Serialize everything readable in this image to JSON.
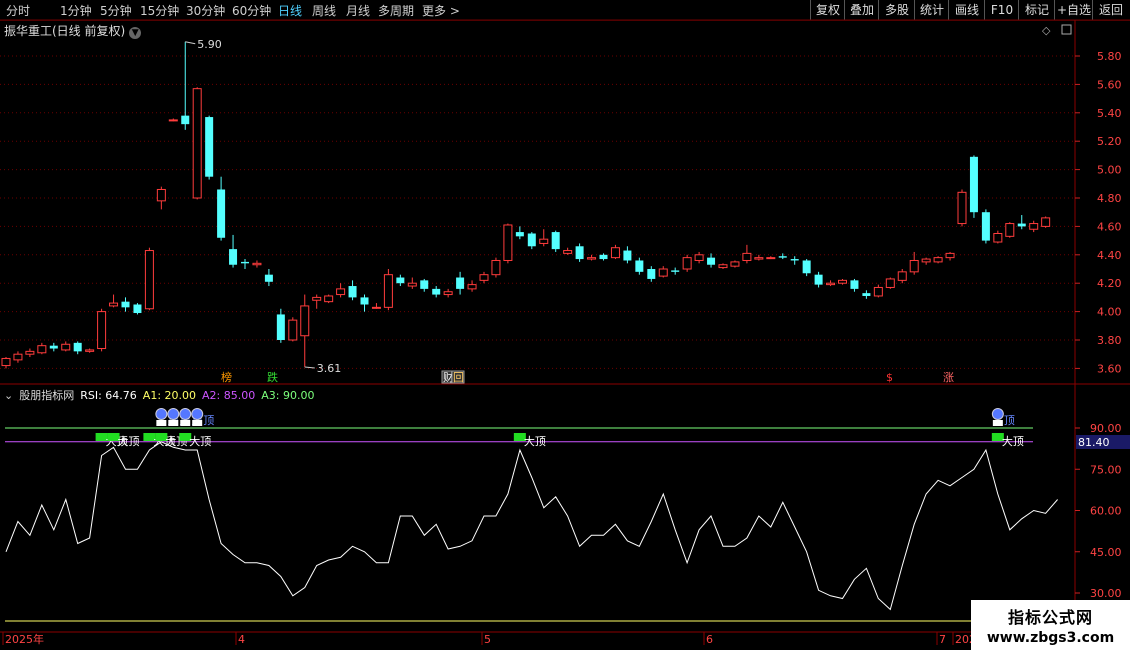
{
  "topbar": {
    "periods": [
      "分时",
      "1分钟",
      "5分钟",
      "15分钟",
      "30分钟",
      "60分钟",
      "日线",
      "周线",
      "月线",
      "多周期",
      "更多 >"
    ],
    "active_period": "日线",
    "buttons": [
      "复权",
      "叠加",
      "多股",
      "统计",
      "画线",
      "F10",
      "标记",
      "+自选",
      "返回"
    ]
  },
  "chart_title": "振华重工(日线 前复权)",
  "price_axis": [
    "5.80",
    "5.60",
    "5.40",
    "5.20",
    "5.00",
    "4.80",
    "4.60",
    "4.40",
    "4.20",
    "4.00",
    "3.80",
    "3.60"
  ],
  "high_label": "5.90",
  "low_label": "3.61",
  "event_markers": [
    {
      "text": "榜",
      "color": "#ff9900"
    },
    {
      "text": "跌",
      "color": "#33dd33"
    },
    {
      "text": "财",
      "color": "#ffffff"
    },
    {
      "text": "回",
      "color": "#ffcc66"
    },
    {
      "text": "$",
      "color": "#ff3333"
    },
    {
      "text": "涨",
      "color": "#ff6666"
    }
  ],
  "indicator": {
    "name": "股朋指标网",
    "rsi_label": "RSI: 64.76",
    "a1_label": "A1: 20.00",
    "a2_label": "A2: 85.00",
    "a3_label": "A3: 90.00",
    "current_tag": "81.40",
    "axis": [
      "90.00",
      "75.00",
      "60.00",
      "45.00",
      "30.00"
    ],
    "signal_texts": {
      "big_top": "大顶",
      "top": "顶"
    }
  },
  "date_axis": [
    "2025年",
    "4",
    "5",
    "6",
    "7",
    "2025"
  ],
  "colors": {
    "up": "#ff3c3c",
    "down": "#54ffff",
    "grid": "#6b0000",
    "a3": "#7cff7c",
    "a2": "#cc55ff",
    "a1": "#ffff66",
    "rsi": "#ffffff"
  },
  "logo": {
    "line1": "指标公式网",
    "line2": "www.zbgs3.com"
  },
  "chart_data": {
    "type": "candlestick",
    "ylim": [
      3.55,
      5.95
    ],
    "candles": [
      [
        3.62,
        3.67,
        3.6,
        3.68
      ],
      [
        3.66,
        3.7,
        3.64,
        3.72
      ],
      [
        3.7,
        3.72,
        3.68,
        3.74
      ],
      [
        3.71,
        3.76,
        3.7,
        3.78
      ],
      [
        3.76,
        3.74,
        3.72,
        3.78
      ],
      [
        3.73,
        3.77,
        3.72,
        3.79
      ],
      [
        3.78,
        3.72,
        3.7,
        3.79
      ],
      [
        3.72,
        3.73,
        3.71,
        3.74
      ],
      [
        3.74,
        4.0,
        3.72,
        4.02
      ],
      [
        4.04,
        4.06,
        4.03,
        4.12
      ],
      [
        4.07,
        4.03,
        4.0,
        4.1
      ],
      [
        4.05,
        3.99,
        3.98,
        4.06
      ],
      [
        4.02,
        4.43,
        4.01,
        4.45
      ],
      [
        4.78,
        4.86,
        4.72,
        4.88
      ],
      [
        5.35,
        5.35,
        5.34,
        5.36
      ],
      [
        5.38,
        5.32,
        5.28,
        5.9
      ],
      [
        4.8,
        5.57,
        4.79,
        5.58
      ],
      [
        5.37,
        4.95,
        4.93,
        5.38
      ],
      [
        4.86,
        4.52,
        4.5,
        4.95
      ],
      [
        4.44,
        4.33,
        4.31,
        4.54
      ],
      [
        4.35,
        4.34,
        4.3,
        4.37
      ],
      [
        4.33,
        4.34,
        4.31,
        4.36
      ],
      [
        4.26,
        4.21,
        4.18,
        4.3
      ],
      [
        3.98,
        3.8,
        3.78,
        4.02
      ],
      [
        3.8,
        3.94,
        3.79,
        3.96
      ],
      [
        3.83,
        4.04,
        3.61,
        4.12
      ],
      [
        4.08,
        4.1,
        4.02,
        4.12
      ],
      [
        4.07,
        4.11,
        4.06,
        4.12
      ],
      [
        4.12,
        4.16,
        4.1,
        4.2
      ],
      [
        4.18,
        4.1,
        4.08,
        4.22
      ],
      [
        4.1,
        4.05,
        4.0,
        4.12
      ],
      [
        4.03,
        4.03,
        4.02,
        4.06
      ],
      [
        4.03,
        4.26,
        4.01,
        4.3
      ],
      [
        4.24,
        4.2,
        4.18,
        4.26
      ],
      [
        4.18,
        4.2,
        4.16,
        4.24
      ],
      [
        4.22,
        4.16,
        4.14,
        4.23
      ],
      [
        4.16,
        4.12,
        4.1,
        4.18
      ],
      [
        4.12,
        4.14,
        4.1,
        4.16
      ],
      [
        4.24,
        4.16,
        4.12,
        4.28
      ],
      [
        4.16,
        4.19,
        4.14,
        4.22
      ],
      [
        4.22,
        4.26,
        4.2,
        4.28
      ],
      [
        4.26,
        4.36,
        4.24,
        4.38
      ],
      [
        4.36,
        4.61,
        4.34,
        4.62
      ],
      [
        4.56,
        4.53,
        4.51,
        4.6
      ],
      [
        4.55,
        4.46,
        4.44,
        4.56
      ],
      [
        4.48,
        4.51,
        4.46,
        4.58
      ],
      [
        4.56,
        4.44,
        4.42,
        4.57
      ],
      [
        4.41,
        4.43,
        4.4,
        4.45
      ],
      [
        4.46,
        4.37,
        4.35,
        4.48
      ],
      [
        4.37,
        4.38,
        4.36,
        4.4
      ],
      [
        4.4,
        4.37,
        4.36,
        4.41
      ],
      [
        4.38,
        4.45,
        4.37,
        4.47
      ],
      [
        4.43,
        4.36,
        4.34,
        4.46
      ],
      [
        4.36,
        4.28,
        4.26,
        4.38
      ],
      [
        4.3,
        4.23,
        4.21,
        4.32
      ],
      [
        4.25,
        4.3,
        4.24,
        4.32
      ],
      [
        4.29,
        4.28,
        4.26,
        4.31
      ],
      [
        4.3,
        4.38,
        4.28,
        4.4
      ],
      [
        4.36,
        4.4,
        4.34,
        4.42
      ],
      [
        4.38,
        4.33,
        4.31,
        4.41
      ],
      [
        4.31,
        4.33,
        4.3,
        4.34
      ],
      [
        4.32,
        4.35,
        4.31,
        4.36
      ],
      [
        4.36,
        4.41,
        4.34,
        4.47
      ],
      [
        4.37,
        4.38,
        4.36,
        4.4
      ],
      [
        4.38,
        4.38,
        4.37,
        4.39
      ],
      [
        4.39,
        4.38,
        4.37,
        4.41
      ],
      [
        4.37,
        4.36,
        4.33,
        4.39
      ],
      [
        4.36,
        4.27,
        4.25,
        4.37
      ],
      [
        4.26,
        4.19,
        4.17,
        4.28
      ],
      [
        4.19,
        4.2,
        4.18,
        4.22
      ],
      [
        4.2,
        4.22,
        4.19,
        4.23
      ],
      [
        4.22,
        4.16,
        4.14,
        4.23
      ],
      [
        4.13,
        4.11,
        4.09,
        4.15
      ],
      [
        4.11,
        4.17,
        4.1,
        4.19
      ],
      [
        4.17,
        4.23,
        4.16,
        4.24
      ],
      [
        4.22,
        4.28,
        4.2,
        4.3
      ],
      [
        4.28,
        4.36,
        4.26,
        4.42
      ],
      [
        4.35,
        4.37,
        4.33,
        4.38
      ],
      [
        4.35,
        4.38,
        4.34,
        4.39
      ],
      [
        4.38,
        4.41,
        4.36,
        4.42
      ],
      [
        4.62,
        4.84,
        4.6,
        4.86
      ],
      [
        5.09,
        4.7,
        4.66,
        5.1
      ],
      [
        4.7,
        4.5,
        4.48,
        4.72
      ],
      [
        4.49,
        4.55,
        4.48,
        4.57
      ],
      [
        4.53,
        4.62,
        4.52,
        4.63
      ],
      [
        4.62,
        4.6,
        4.58,
        4.68
      ],
      [
        4.58,
        4.62,
        4.56,
        4.64
      ],
      [
        4.6,
        4.66,
        4.59,
        4.67
      ]
    ],
    "rsi": [
      45,
      56,
      51,
      62,
      53,
      64,
      48,
      50,
      80,
      83,
      75,
      75,
      82,
      85,
      83,
      82,
      82,
      64,
      48,
      44,
      41,
      41,
      40,
      36,
      29,
      32,
      40,
      42,
      43,
      47,
      45,
      41,
      41,
      58,
      58,
      51,
      55,
      46,
      47,
      49,
      58,
      58,
      66,
      82,
      72,
      61,
      65,
      58,
      47,
      51,
      51,
      55,
      49,
      47,
      56,
      66,
      53,
      41,
      53,
      58,
      47,
      47,
      50,
      58,
      54,
      63,
      54,
      45,
      31,
      29,
      28,
      35,
      39,
      28,
      24,
      40,
      55,
      66,
      71,
      69,
      72,
      75,
      82,
      66,
      53,
      57,
      60,
      59,
      64
    ]
  }
}
